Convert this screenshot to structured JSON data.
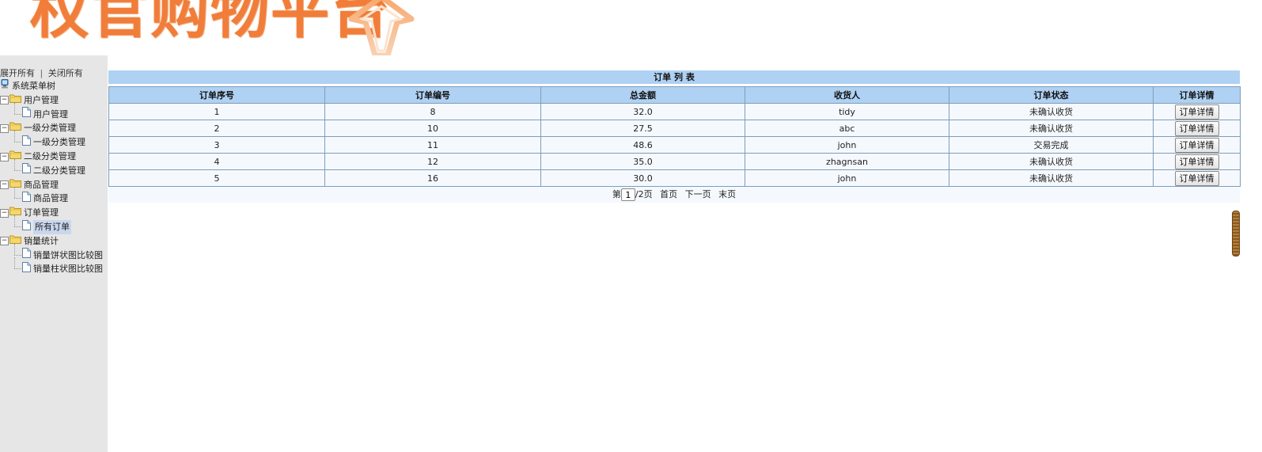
{
  "header": {
    "logo_text": "权官购物平台"
  },
  "sidebar": {
    "expand_all": "展开所有",
    "separator": "|",
    "collapse_all": "关闭所有",
    "tree": [
      {
        "label": "系统菜单树",
        "type": "root",
        "icon": "computer-icon",
        "level": 0
      },
      {
        "label": "用户管理",
        "type": "folder",
        "icon": "folder-icon",
        "level": 1
      },
      {
        "label": "用户管理",
        "type": "page",
        "icon": "page-icon",
        "level": 2
      },
      {
        "label": "一级分类管理",
        "type": "folder",
        "icon": "folder-icon",
        "level": 1
      },
      {
        "label": "一级分类管理",
        "type": "page",
        "icon": "page-icon",
        "level": 2
      },
      {
        "label": "二级分类管理",
        "type": "folder",
        "icon": "folder-icon",
        "level": 1
      },
      {
        "label": "二级分类管理",
        "type": "page",
        "icon": "page-icon",
        "level": 2
      },
      {
        "label": "商品管理",
        "type": "folder",
        "icon": "folder-icon",
        "level": 1
      },
      {
        "label": "商品管理",
        "type": "page",
        "icon": "page-icon",
        "level": 2
      },
      {
        "label": "订单管理",
        "type": "folder",
        "icon": "folder-icon",
        "level": 1
      },
      {
        "label": "所有订单",
        "type": "page",
        "icon": "page-icon",
        "level": 2,
        "selected": true
      },
      {
        "label": "销量统计",
        "type": "folder",
        "icon": "folder-icon",
        "level": 1
      },
      {
        "label": "销量饼状图比较图",
        "type": "page",
        "icon": "page-icon",
        "level": 2
      },
      {
        "label": "销量柱状图比较图",
        "type": "page",
        "icon": "page-icon",
        "level": 2
      }
    ]
  },
  "main": {
    "title": "订单 列 表",
    "columns": [
      "订单序号",
      "订单编号",
      "总金额",
      "收货人",
      "订单状态",
      "订单详情"
    ],
    "rows": [
      {
        "seq": "1",
        "order_no": "8",
        "total": "32.0",
        "receiver": "tidy",
        "status": "未确认收货",
        "action": "订单详情"
      },
      {
        "seq": "2",
        "order_no": "10",
        "total": "27.5",
        "receiver": "abc",
        "status": "未确认收货",
        "action": "订单详情"
      },
      {
        "seq": "3",
        "order_no": "11",
        "total": "48.6",
        "receiver": "john",
        "status": "交易完成",
        "action": "订单详情"
      },
      {
        "seq": "4",
        "order_no": "12",
        "total": "35.0",
        "receiver": "zhagnsan",
        "status": "未确认收货",
        "action": "订单详情"
      },
      {
        "seq": "5",
        "order_no": "16",
        "total": "30.0",
        "receiver": "john",
        "status": "未确认收货",
        "action": "订单详情"
      }
    ],
    "pager": {
      "prefix": "第",
      "current_page": "1",
      "suffix": "/2页",
      "first": "首页",
      "next": "下一页",
      "last": "末页"
    }
  },
  "colors": {
    "header_blue": "#afd1f3",
    "cell_bg": "#f5f9fd",
    "sidebar_bg": "#e6e6e6",
    "logo_orange": "#f07d3a"
  }
}
